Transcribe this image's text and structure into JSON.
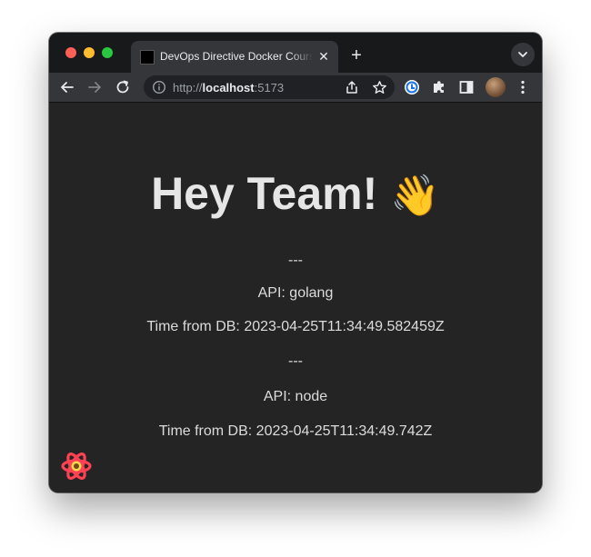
{
  "browser": {
    "tab": {
      "title": "DevOps Directive Docker Course",
      "close_glyph": "✕"
    },
    "new_tab_glyph": "+",
    "address_bar": {
      "scheme": "http://",
      "host": "localhost",
      "port": ":5173"
    },
    "icons": {
      "back": "arrow-left-icon",
      "forward": "arrow-right-icon",
      "reload": "reload-icon",
      "info": "info-icon",
      "share": "share-icon",
      "bookmark": "star-icon",
      "extension_1": "extension-icon",
      "extensions": "puzzle-icon",
      "sidepanel": "side-panel-icon",
      "menu": "kebab-menu-icon",
      "tab_search": "chevron-down-icon"
    },
    "colors": {
      "close": "#fe5f57",
      "minimize": "#febc2e",
      "maximize": "#28c840"
    }
  },
  "page": {
    "heading": "Hey Team!",
    "heading_emoji": "👋",
    "items": [
      {
        "text": "---"
      },
      {
        "text": "API: golang"
      },
      {
        "text": "Time from DB: 2023-04-25T11:34:49.582459Z"
      },
      {
        "text": "---"
      },
      {
        "text": "API: node"
      },
      {
        "text": "Time from DB: 2023-04-25T11:34:49.742Z"
      }
    ],
    "background": "#242424"
  }
}
